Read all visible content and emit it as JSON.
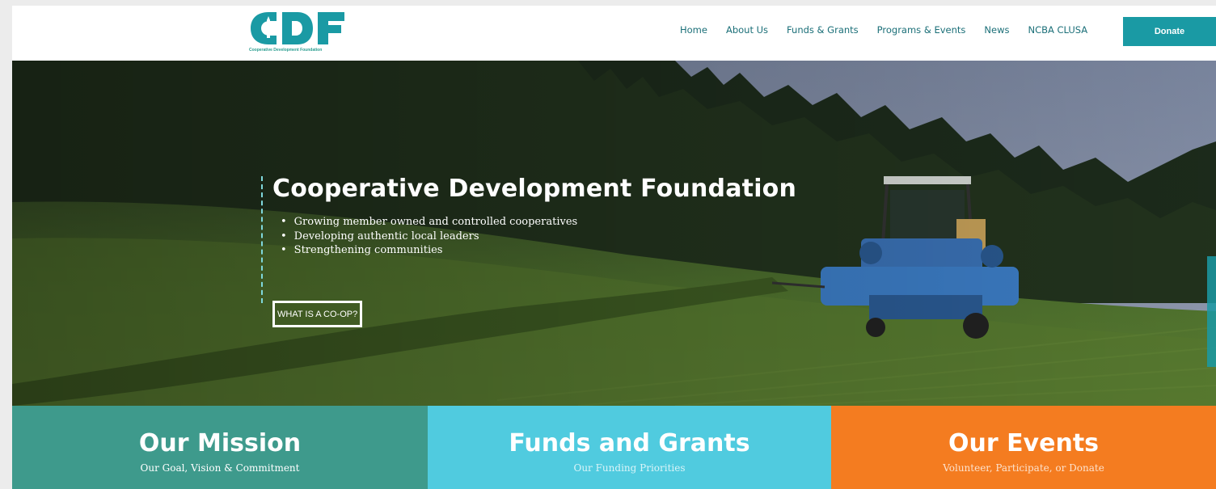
{
  "header": {
    "logo_text": "CDF",
    "logo_tagline": "Cooperative Development Foundation",
    "nav": [
      "Home",
      "About Us",
      "Funds & Grants",
      "Programs & Events",
      "News",
      "NCBA CLUSA"
    ],
    "donate_label": "Donate"
  },
  "hero": {
    "title": "Cooperative Development Foundation",
    "bullets": [
      "Growing member owned and controlled cooperatives",
      "Developing authentic local leaders",
      "Strengthening communities"
    ],
    "cta_label": "WHAT IS A CO-OP?"
  },
  "panels": [
    {
      "title": "Our Mission",
      "subtitle": "Our Goal, Vision & Commitment"
    },
    {
      "title": "Funds and Grants",
      "subtitle": "Our Funding Priorities"
    },
    {
      "title": "Our Events",
      "subtitle": "Volunteer, Participate, or Donate"
    }
  ],
  "colors": {
    "brand_teal": "#1a9aa4",
    "mission_green": "#3e9a8c",
    "grants_cyan": "#50cbdf",
    "events_orange": "#f47c20"
  }
}
